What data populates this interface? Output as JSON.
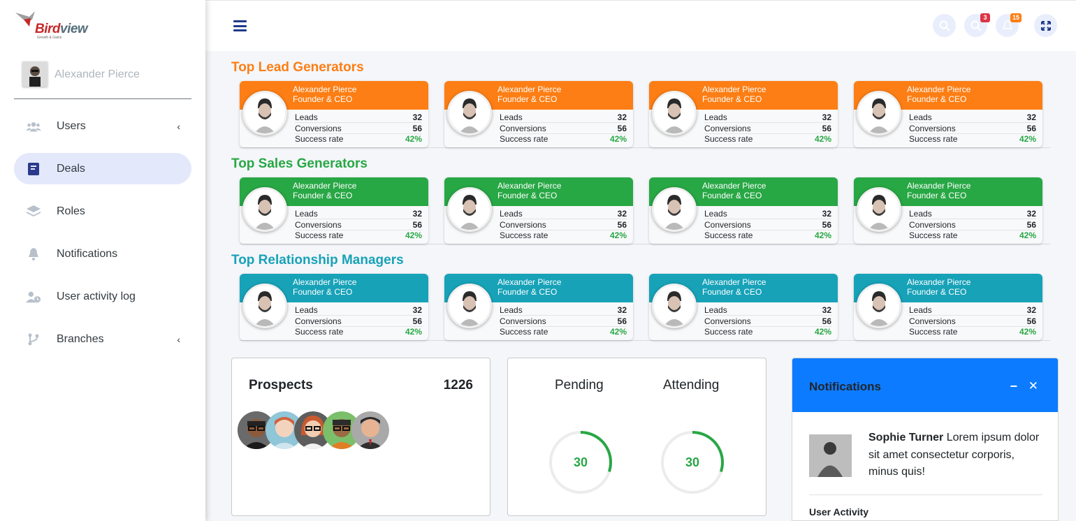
{
  "brand": {
    "name_part1": "Bird",
    "name_part2": "view",
    "tagline": "Growth & Gains"
  },
  "user": {
    "name": "Alexander Pierce"
  },
  "sidebar": {
    "items": [
      {
        "label": "Users",
        "icon": "users-icon",
        "has_arrow": true,
        "arrow": "‹"
      },
      {
        "label": "Deals",
        "icon": "book-icon",
        "active": true
      },
      {
        "label": "Roles",
        "icon": "layers-icon"
      },
      {
        "label": "Notifications",
        "icon": "bell-icon"
      },
      {
        "label": "User activity log",
        "icon": "user-clock-icon"
      },
      {
        "label": "Branches",
        "icon": "branch-icon",
        "has_arrow": true,
        "arrow": "‹"
      }
    ]
  },
  "header": {
    "menu_icon": "hamburger-icon",
    "buttons": [
      {
        "icon": "search-icon"
      },
      {
        "icon": "chat-icon",
        "badge": "3",
        "badge_color": "#dc3545"
      },
      {
        "icon": "bell-icon",
        "badge": "15",
        "badge_color": "#fd7e14"
      },
      {
        "icon": "expand-icon"
      }
    ]
  },
  "colors": {
    "orange": "#fd7e14",
    "green": "#28a745",
    "teal": "#17a2b8",
    "blue": "#0d7bff",
    "success_text": "#28a745"
  },
  "sections": [
    {
      "title": "Top Lead Generators",
      "color": "#fd7e14",
      "title_color": "#fd7e14",
      "cards": [
        {
          "name": "Alexander Pierce",
          "role": "Founder & CEO",
          "leads_label": "Leads",
          "leads": "32",
          "conversions_label": "Conversions",
          "conversions": "56",
          "success_label": "Success rate",
          "success": "42%"
        },
        {
          "name": "Alexander Pierce",
          "role": "Founder & CEO",
          "leads_label": "Leads",
          "leads": "32",
          "conversions_label": "Conversions",
          "conversions": "56",
          "success_label": "Success rate",
          "success": "42%"
        },
        {
          "name": "Alexander Pierce",
          "role": "Founder & CEO",
          "leads_label": "Leads",
          "leads": "32",
          "conversions_label": "Conversions",
          "conversions": "56",
          "success_label": "Success rate",
          "success": "42%"
        },
        {
          "name": "Alexander Pierce",
          "role": "Founder & CEO",
          "leads_label": "Leads",
          "leads": "32",
          "conversions_label": "Conversions",
          "conversions": "56",
          "success_label": "Success rate",
          "success": "42%"
        }
      ]
    },
    {
      "title": "Top Sales Generators",
      "color": "#28a745",
      "title_color": "#28a745",
      "cards": [
        {
          "name": "Alexander Pierce",
          "role": "Founder & CEO",
          "leads_label": "Leads",
          "leads": "32",
          "conversions_label": "Conversions",
          "conversions": "56",
          "success_label": "Success rate",
          "success": "42%"
        },
        {
          "name": "Alexander Pierce",
          "role": "Founder & CEO",
          "leads_label": "Leads",
          "leads": "32",
          "conversions_label": "Conversions",
          "conversions": "56",
          "success_label": "Success rate",
          "success": "42%"
        },
        {
          "name": "Alexander Pierce",
          "role": "Founder & CEO",
          "leads_label": "Leads",
          "leads": "32",
          "conversions_label": "Conversions",
          "conversions": "56",
          "success_label": "Success rate",
          "success": "42%"
        },
        {
          "name": "Alexander Pierce",
          "role": "Founder & CEO",
          "leads_label": "Leads",
          "leads": "32",
          "conversions_label": "Conversions",
          "conversions": "56",
          "success_label": "Success rate",
          "success": "42%"
        }
      ]
    },
    {
      "title": "Top Relationship Managers",
      "color": "#17a2b8",
      "title_color": "#17a2b8",
      "cards": [
        {
          "name": "Alexander Pierce",
          "role": "Founder & CEO",
          "leads_label": "Leads",
          "leads": "32",
          "conversions_label": "Conversions",
          "conversions": "56",
          "success_label": "Success rate",
          "success": "42%"
        },
        {
          "name": "Alexander Pierce",
          "role": "Founder & CEO",
          "leads_label": "Leads",
          "leads": "32",
          "conversions_label": "Conversions",
          "conversions": "56",
          "success_label": "Success rate",
          "success": "42%"
        },
        {
          "name": "Alexander Pierce",
          "role": "Founder & CEO",
          "leads_label": "Leads",
          "leads": "32",
          "conversions_label": "Conversions",
          "conversions": "56",
          "success_label": "Success rate",
          "success": "42%"
        },
        {
          "name": "Alexander Pierce",
          "role": "Founder & CEO",
          "leads_label": "Leads",
          "leads": "32",
          "conversions_label": "Conversions",
          "conversions": "56",
          "success_label": "Success rate",
          "success": "42%"
        }
      ]
    }
  ],
  "prospects": {
    "title": "Prospects",
    "count": "1226",
    "avatars": 5
  },
  "status": {
    "pending": {
      "label": "Pending",
      "value": "30",
      "fraction": 0.3
    },
    "attending": {
      "label": "Attending",
      "value": "30",
      "fraction": 0.3
    }
  },
  "notifications": {
    "title": "Notifications",
    "minimize_icon": "minus-icon",
    "close_icon": "close-icon",
    "item": {
      "author": "Sophie Turner",
      "text": " Lorem ipsum dolor sit amet consectetur corporis, minus quis!"
    },
    "subheading": "User Activity"
  }
}
